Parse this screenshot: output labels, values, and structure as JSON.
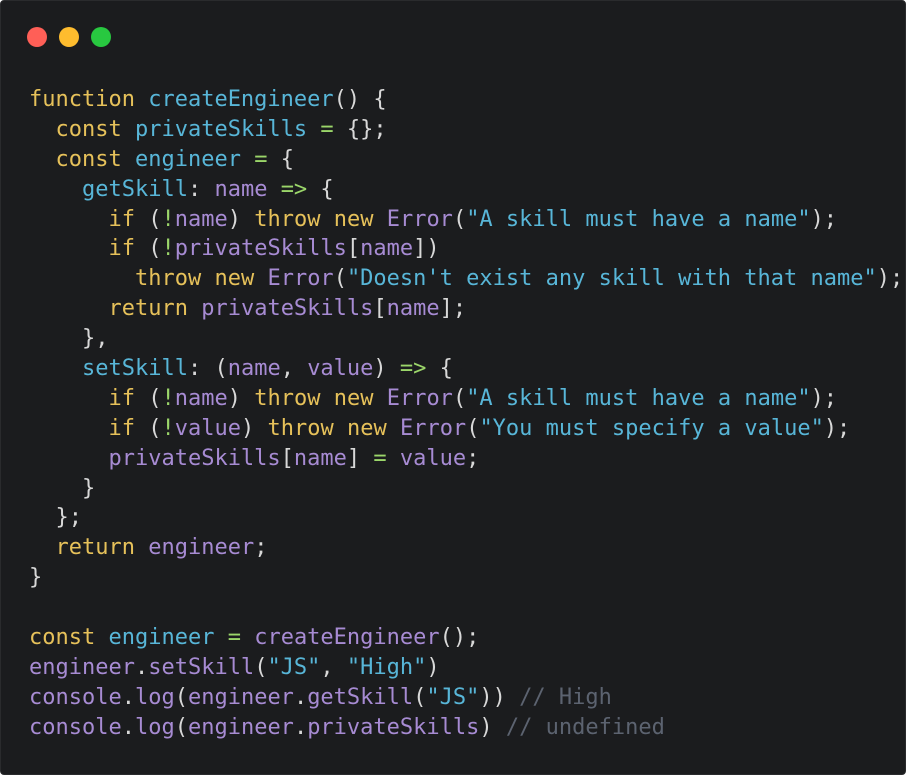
{
  "window": {
    "controls": {
      "close_color": "#ff5f57",
      "minimize_color": "#febc2e",
      "maximize_color": "#28c840"
    }
  },
  "colors": {
    "background": "#1b1c1e",
    "keyword": "#e6c15a",
    "function": "#58b6d8",
    "variable": "#a78bd3",
    "string": "#58b6d8",
    "operator": "#9bd66a",
    "punctuation": "#d8d8d8",
    "comment": "#5c6370"
  },
  "code": {
    "lines": [
      [
        [
          "kw",
          "function"
        ],
        [
          "p",
          " "
        ],
        [
          "fn",
          "createEngineer"
        ],
        [
          "p",
          "() {"
        ]
      ],
      [
        [
          "p",
          "  "
        ],
        [
          "kw",
          "const"
        ],
        [
          "p",
          " "
        ],
        [
          "fn",
          "privateSkills"
        ],
        [
          "p",
          " "
        ],
        [
          "op",
          "="
        ],
        [
          "p",
          " {};"
        ]
      ],
      [
        [
          "p",
          "  "
        ],
        [
          "kw",
          "const"
        ],
        [
          "p",
          " "
        ],
        [
          "fn",
          "engineer"
        ],
        [
          "p",
          " "
        ],
        [
          "op",
          "="
        ],
        [
          "p",
          " {"
        ]
      ],
      [
        [
          "p",
          "    "
        ],
        [
          "fn",
          "getSkill"
        ],
        [
          "p",
          ": "
        ],
        [
          "var",
          "name"
        ],
        [
          "p",
          " "
        ],
        [
          "op",
          "=>"
        ],
        [
          "p",
          " {"
        ]
      ],
      [
        [
          "p",
          "      "
        ],
        [
          "kw",
          "if"
        ],
        [
          "p",
          " ("
        ],
        [
          "op",
          "!"
        ],
        [
          "var",
          "name"
        ],
        [
          "p",
          ") "
        ],
        [
          "kw",
          "throw"
        ],
        [
          "p",
          " "
        ],
        [
          "kw",
          "new"
        ],
        [
          "p",
          " "
        ],
        [
          "var",
          "Error"
        ],
        [
          "p",
          "("
        ],
        [
          "str",
          "\"A skill must have a name\""
        ],
        [
          "p",
          ");"
        ]
      ],
      [
        [
          "p",
          "      "
        ],
        [
          "kw",
          "if"
        ],
        [
          "p",
          " ("
        ],
        [
          "op",
          "!"
        ],
        [
          "var",
          "privateSkills"
        ],
        [
          "p",
          "["
        ],
        [
          "var",
          "name"
        ],
        [
          "p",
          "])"
        ]
      ],
      [
        [
          "p",
          "        "
        ],
        [
          "kw",
          "throw"
        ],
        [
          "p",
          " "
        ],
        [
          "kw",
          "new"
        ],
        [
          "p",
          " "
        ],
        [
          "var",
          "Error"
        ],
        [
          "p",
          "("
        ],
        [
          "str",
          "\"Doesn't exist any skill with that name\""
        ],
        [
          "p",
          ");"
        ]
      ],
      [
        [
          "p",
          "      "
        ],
        [
          "kw",
          "return"
        ],
        [
          "p",
          " "
        ],
        [
          "var",
          "privateSkills"
        ],
        [
          "p",
          "["
        ],
        [
          "var",
          "name"
        ],
        [
          "p",
          "];"
        ]
      ],
      [
        [
          "p",
          "    },"
        ]
      ],
      [
        [
          "p",
          "    "
        ],
        [
          "fn",
          "setSkill"
        ],
        [
          "p",
          ": ("
        ],
        [
          "var",
          "name"
        ],
        [
          "p",
          ", "
        ],
        [
          "var",
          "value"
        ],
        [
          "p",
          ") "
        ],
        [
          "op",
          "=>"
        ],
        [
          "p",
          " {"
        ]
      ],
      [
        [
          "p",
          "      "
        ],
        [
          "kw",
          "if"
        ],
        [
          "p",
          " ("
        ],
        [
          "op",
          "!"
        ],
        [
          "var",
          "name"
        ],
        [
          "p",
          ") "
        ],
        [
          "kw",
          "throw"
        ],
        [
          "p",
          " "
        ],
        [
          "kw",
          "new"
        ],
        [
          "p",
          " "
        ],
        [
          "var",
          "Error"
        ],
        [
          "p",
          "("
        ],
        [
          "str",
          "\"A skill must have a name\""
        ],
        [
          "p",
          ");"
        ]
      ],
      [
        [
          "p",
          "      "
        ],
        [
          "kw",
          "if"
        ],
        [
          "p",
          " ("
        ],
        [
          "op",
          "!"
        ],
        [
          "var",
          "value"
        ],
        [
          "p",
          ") "
        ],
        [
          "kw",
          "throw"
        ],
        [
          "p",
          " "
        ],
        [
          "kw",
          "new"
        ],
        [
          "p",
          " "
        ],
        [
          "var",
          "Error"
        ],
        [
          "p",
          "("
        ],
        [
          "str",
          "\"You must specify a value\""
        ],
        [
          "p",
          ");"
        ]
      ],
      [
        [
          "p",
          "      "
        ],
        [
          "var",
          "privateSkills"
        ],
        [
          "p",
          "["
        ],
        [
          "var",
          "name"
        ],
        [
          "p",
          "] "
        ],
        [
          "op",
          "="
        ],
        [
          "p",
          " "
        ],
        [
          "var",
          "value"
        ],
        [
          "p",
          ";"
        ]
      ],
      [
        [
          "p",
          "    }"
        ]
      ],
      [
        [
          "p",
          "  };"
        ]
      ],
      [
        [
          "p",
          "  "
        ],
        [
          "kw",
          "return"
        ],
        [
          "p",
          " "
        ],
        [
          "var",
          "engineer"
        ],
        [
          "p",
          ";"
        ]
      ],
      [
        [
          "p",
          "}"
        ]
      ],
      [],
      [
        [
          "kw",
          "const"
        ],
        [
          "p",
          " "
        ],
        [
          "fn",
          "engineer"
        ],
        [
          "p",
          " "
        ],
        [
          "op",
          "="
        ],
        [
          "p",
          " "
        ],
        [
          "var",
          "createEngineer"
        ],
        [
          "p",
          "();"
        ]
      ],
      [
        [
          "var",
          "engineer"
        ],
        [
          "p",
          "."
        ],
        [
          "var",
          "setSkill"
        ],
        [
          "p",
          "("
        ],
        [
          "str",
          "\"JS\""
        ],
        [
          "p",
          ", "
        ],
        [
          "str",
          "\"High\""
        ],
        [
          "p",
          ")"
        ]
      ],
      [
        [
          "var",
          "console"
        ],
        [
          "p",
          "."
        ],
        [
          "var",
          "log"
        ],
        [
          "p",
          "("
        ],
        [
          "var",
          "engineer"
        ],
        [
          "p",
          "."
        ],
        [
          "var",
          "getSkill"
        ],
        [
          "p",
          "("
        ],
        [
          "str",
          "\"JS\""
        ],
        [
          "p",
          ")) "
        ],
        [
          "cmt",
          "// High"
        ]
      ],
      [
        [
          "var",
          "console"
        ],
        [
          "p",
          "."
        ],
        [
          "var",
          "log"
        ],
        [
          "p",
          "("
        ],
        [
          "var",
          "engineer"
        ],
        [
          "p",
          "."
        ],
        [
          "var",
          "privateSkills"
        ],
        [
          "p",
          ") "
        ],
        [
          "cmt",
          "// undefined"
        ]
      ]
    ]
  }
}
